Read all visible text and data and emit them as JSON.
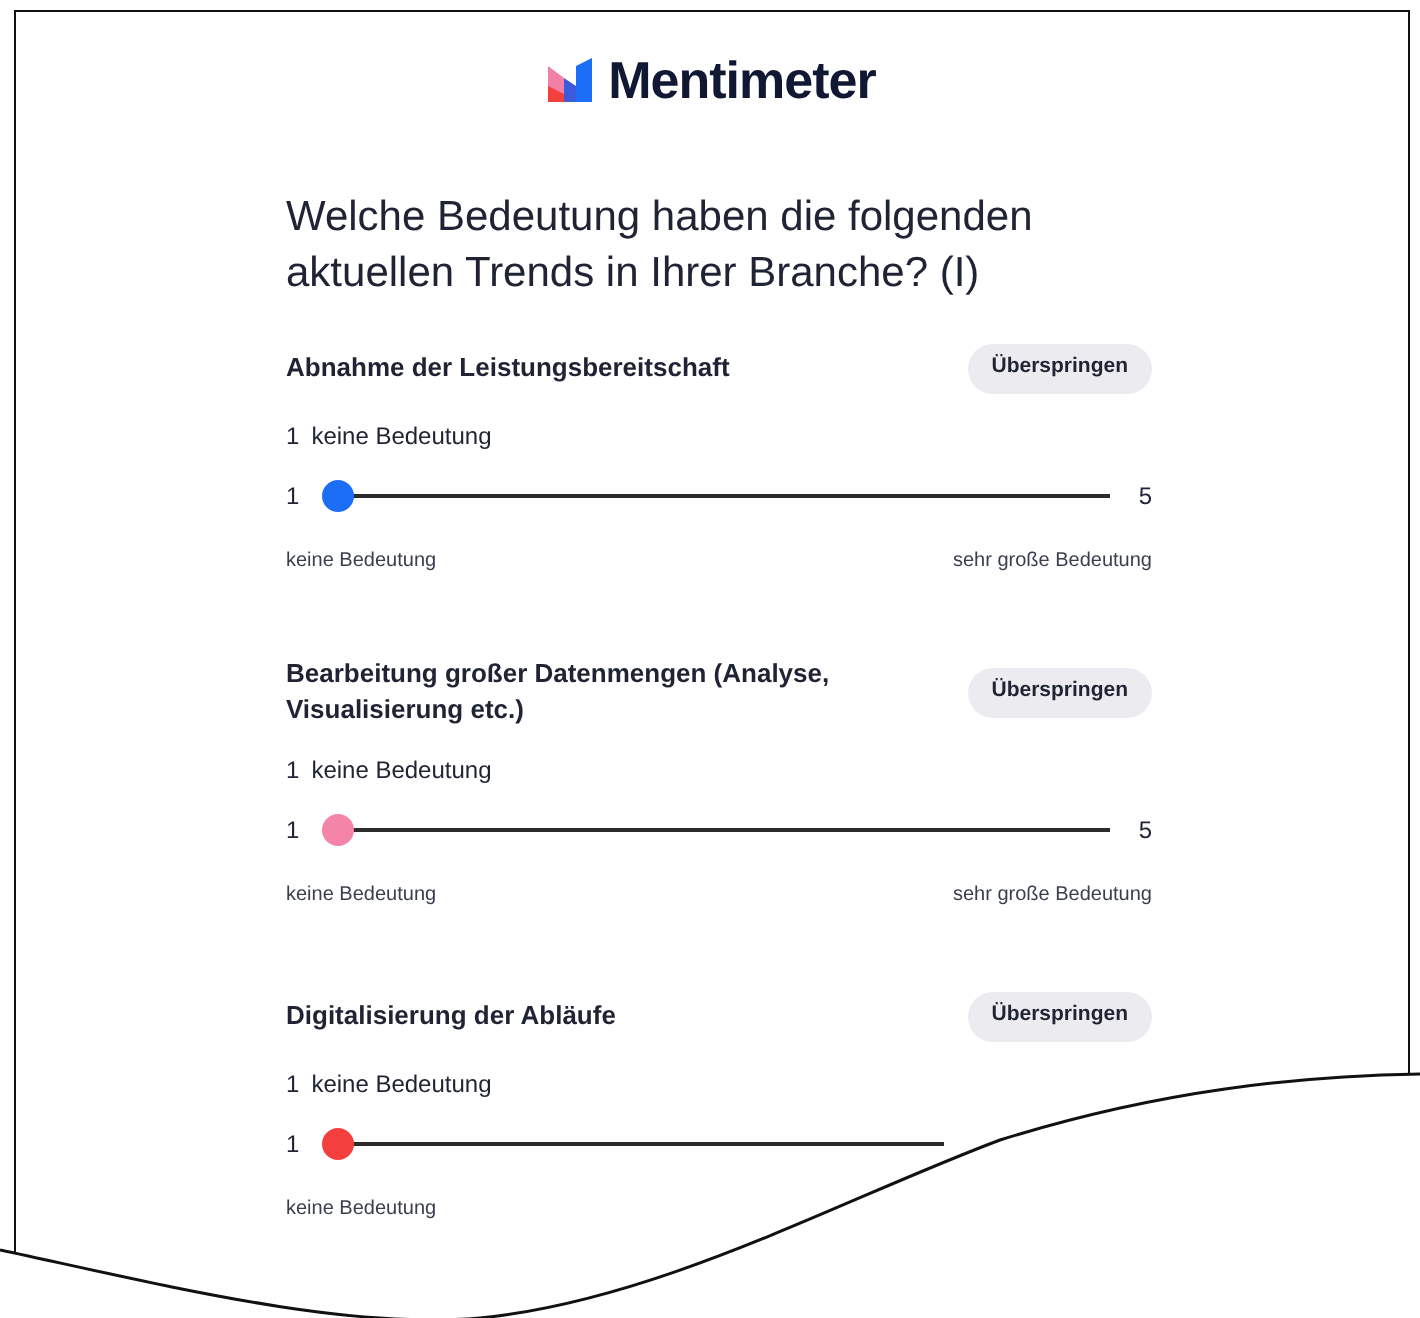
{
  "logo": {
    "text": "Mentimeter"
  },
  "question": "Welche Bedeutung haben die folgenden aktuellen Trends in Ihrer Branche? (I)",
  "items": [
    {
      "title": "Abnahme der Leistungsbereitschaft",
      "skip": "Überspringen",
      "value_number": "1",
      "value_label": "keine Bedeutung",
      "min": "1",
      "max": "5",
      "level": 0,
      "color": "#1d6ef7",
      "left_label": "keine Bedeutung",
      "right_label": "sehr große Bedeutung"
    },
    {
      "title": "Bearbeitung großer Datenmengen (Analyse, Visualisierung etc.)",
      "skip": "Überspringen",
      "value_number": "1",
      "value_label": "keine Bedeutung",
      "min": "1",
      "max": "5",
      "level": 0,
      "color": "#f484a8",
      "left_label": "keine Bedeutung",
      "right_label": "sehr große Bedeutung"
    },
    {
      "title": "Digitalisierung der Abläufe",
      "skip": "Überspringen",
      "value_number": "1",
      "value_label": "keine Bedeutung",
      "min": "1",
      "level": 0,
      "color": "#f43f3f",
      "left_label": "keine Bedeutung"
    }
  ]
}
